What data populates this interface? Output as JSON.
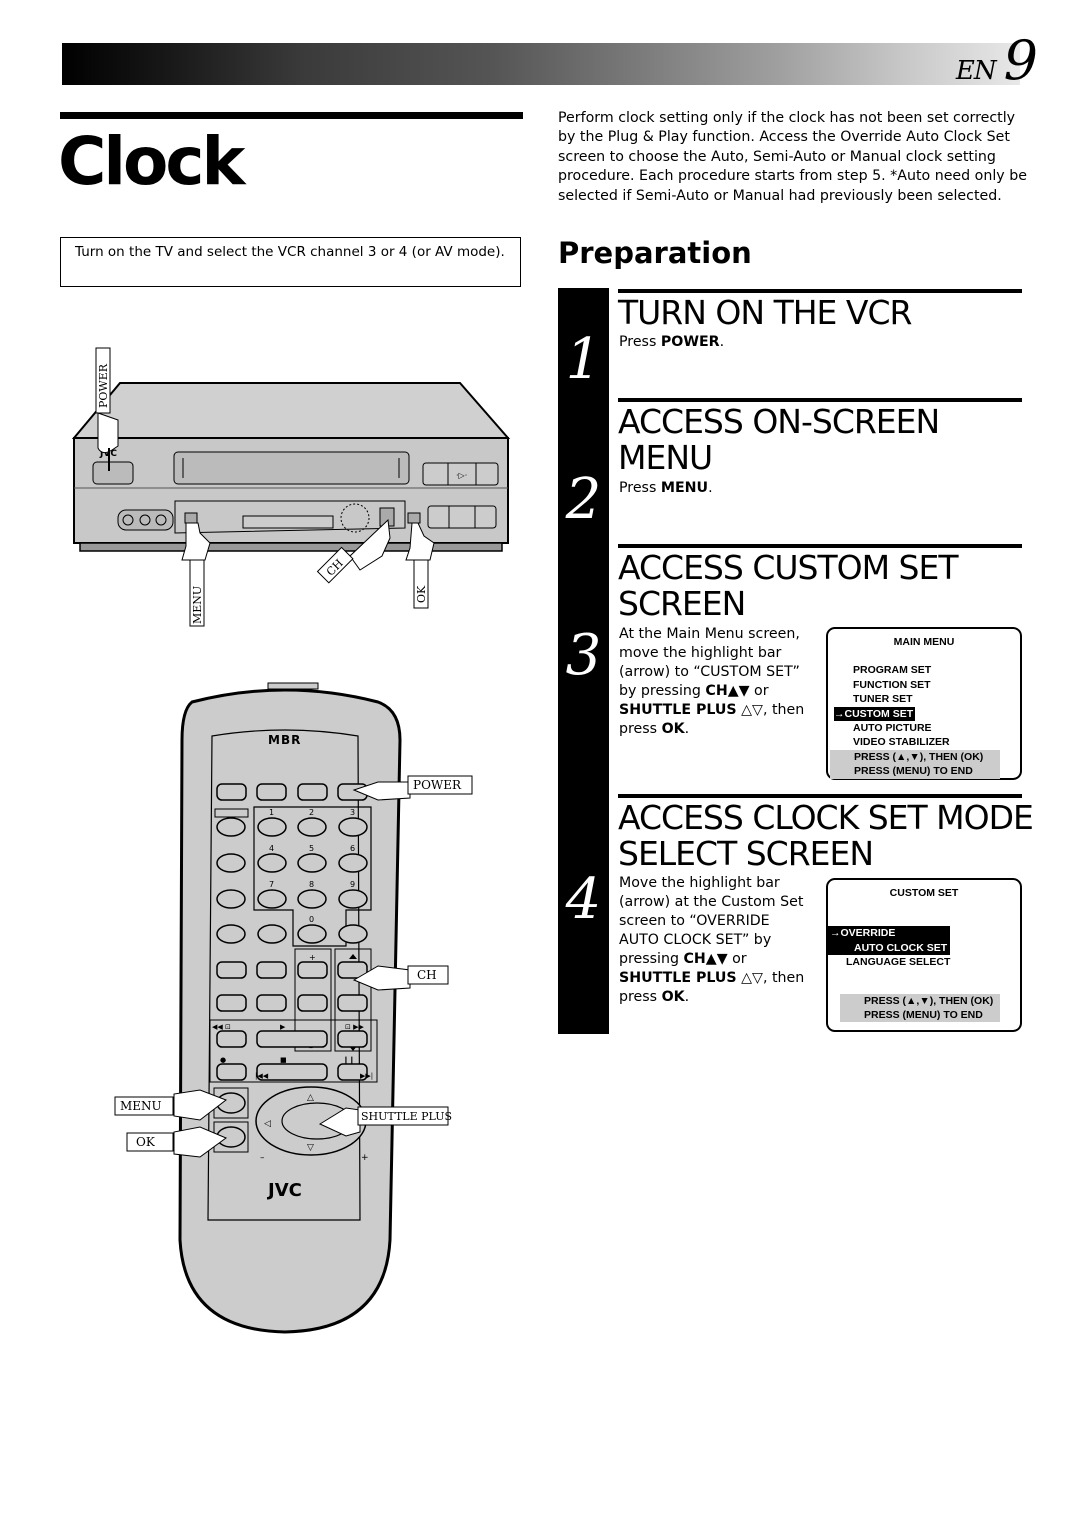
{
  "header": {
    "language": "EN",
    "page_number": "9"
  },
  "title": "Clock",
  "note": "Turn on the TV and select the VCR channel 3 or 4 (or AV mode).",
  "intro": "Perform clock setting only if the clock has not been set correctly by the Plug & Play function. Access the Override Auto Clock Set screen to choose the Auto, Semi-Auto or Manual clock setting procedure. Each procedure starts from step 5. *Auto need only be selected if Semi-Auto or Manual had previously been selected.",
  "preparation_heading": "Preparation",
  "steps": [
    {
      "number": "1",
      "title_lines": [
        "TURN ON THE VCR"
      ],
      "body": {
        "pre": "Press ",
        "bold": "POWER",
        "post": "."
      }
    },
    {
      "number": "2",
      "title_lines": [
        "ACCESS ON-SCREEN",
        "MENU"
      ],
      "body": {
        "pre": "Press ",
        "bold": "MENU",
        "post": "."
      }
    },
    {
      "number": "3",
      "title_lines": [
        "ACCESS CUSTOM SET",
        "SCREEN"
      ],
      "body_lines": [
        "At the Main Menu screen,",
        "move the highlight bar",
        "(arrow) to “CUSTOM SET”"
      ],
      "body_tail": {
        "line1_pre": "by pressing ",
        "line1_bold": "CH▲▼",
        "line1_post": " or",
        "line2_bold": "SHUTTLE PLUS",
        "line2_post": " △▽, then",
        "line3_pre": "press ",
        "line3_bold": "OK",
        "line3_post": "."
      }
    },
    {
      "number": "4",
      "title_lines": [
        "ACCESS CLOCK SET MODE",
        "SELECT SCREEN"
      ],
      "body_lines": [
        "Move the highlight bar",
        "(arrow) at the Custom Set",
        "screen to “OVERRIDE",
        "AUTO CLOCK SET” by"
      ],
      "body_tail": {
        "line1_pre": "pressing ",
        "line1_bold": "CH▲▼",
        "line1_post": " or",
        "line2_bold": "SHUTTLE PLUS",
        "line2_post": " △▽, then",
        "line3_pre": "press ",
        "line3_bold": "OK",
        "line3_post": "."
      }
    }
  ],
  "main_menu_screen": {
    "title": "MAIN MENU",
    "items": [
      "PROGRAM SET",
      "FUNCTION SET",
      "TUNER SET",
      "CUSTOM SET",
      "AUTO PICTURE",
      "VIDEO STABILIZER"
    ],
    "selected": "CUSTOM SET",
    "arrow": "→",
    "footer": [
      "PRESS (▲,▼), THEN (OK)",
      "PRESS (MENU) TO END"
    ]
  },
  "custom_set_screen": {
    "title": "CUSTOM SET",
    "selected_lines": [
      "OVERRIDE",
      "AUTO CLOCK SET"
    ],
    "items": [
      "LANGUAGE SELECT"
    ],
    "arrow": "→",
    "footer": [
      "PRESS (▲,▼), THEN (OK)",
      "PRESS (MENU) TO END"
    ]
  },
  "vcr_illustration": {
    "brand": "JVC",
    "callouts": {
      "power": "POWER",
      "menu": "MENU",
      "ch": "CH",
      "ok": "OK"
    }
  },
  "remote_illustration": {
    "brand_top": "MBR",
    "brand_bottom": "JVC",
    "digits": [
      "1",
      "2",
      "3",
      "4",
      "5",
      "6",
      "7",
      "8",
      "9",
      "0"
    ],
    "callouts": {
      "power": "POWER",
      "ch": "CH",
      "menu": "MENU",
      "ok": "OK",
      "shuttle_plus": "SHUTTLE PLUS"
    },
    "markers": {
      "plus": "+",
      "minus": "–"
    }
  }
}
